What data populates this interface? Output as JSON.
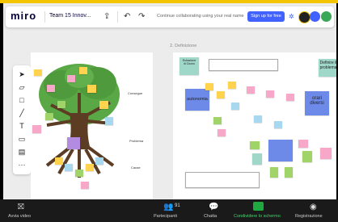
{
  "app": {
    "logo": "miro",
    "board_name": "Team 15 Innov...",
    "promo_text": "Continue collaborating using your real name",
    "signup_label": "Sign up for free",
    "accent": "#4262ff"
  },
  "frames": {
    "frame2_title": "2. Definizione"
  },
  "tree_labels": {
    "label_top": "Consegue",
    "label_mid": "Problema",
    "label_low": "Cause"
  },
  "frame2_stickies": {
    "top_left_title": "Estrazione di Ozono",
    "definire": "Definire il problema",
    "autonomia": "autonomia",
    "orari": "orari diversi"
  },
  "toolbar_icons": [
    "pointer-icon",
    "note-icon",
    "shape-icon",
    "pen-icon",
    "text-icon",
    "comment-icon",
    "frame-icon",
    "more-icon"
  ],
  "bottom_bar": {
    "stop_video": "Avvia video",
    "participants": "Partecipanti",
    "participants_count": "91",
    "chat": "Chatta",
    "share": "Condividere lo schermo",
    "record": "Registrazione"
  }
}
